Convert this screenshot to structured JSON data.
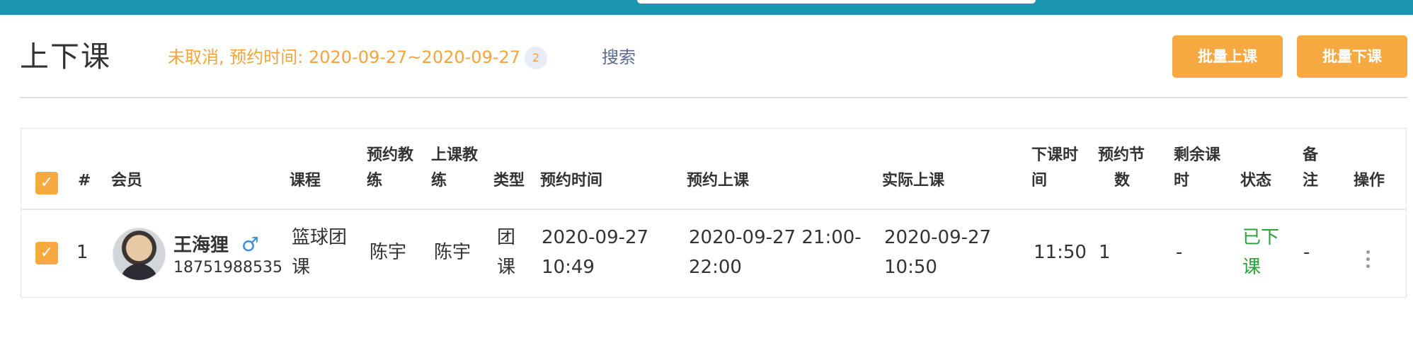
{
  "page": {
    "title": "上下课",
    "filter_text": "未取消, 预约时间: 2020-09-27~2020-09-27",
    "filter_count": "2",
    "search_label": "搜索"
  },
  "toolbar": {
    "batch_start": "批量上课",
    "batch_end": "批量下课"
  },
  "colors": {
    "topbar": "#1a96ae",
    "accent": "#f7a941",
    "status_done": "#2aa13b"
  },
  "table": {
    "headers": {
      "index": "#",
      "member": "会员",
      "course": "课程",
      "booked_coach_1": "预约教",
      "booked_coach_2": "练",
      "class_coach_1": "上课教",
      "class_coach_2": "练",
      "type": "类型",
      "booking_time": "预约时间",
      "booked_class": "预约上课",
      "actual_class": "实际上课",
      "end_time_1": "下课时",
      "end_time_2": "间",
      "sessions_1": "预约节",
      "sessions_2": "数",
      "remaining_1": "剩余课",
      "remaining_2": "时",
      "status": "状态",
      "remark_1": "备",
      "remark_2": "注",
      "actions": "操作"
    },
    "rows": [
      {
        "index": "1",
        "member_name": "王海狸",
        "member_gender": "♂",
        "member_phone": "18751988535",
        "course_1": "篮球团",
        "course_2": "课",
        "booked_coach": "陈宇",
        "class_coach": "陈宇",
        "type_1": "团",
        "type_2": "课",
        "booking_date": "2020-09-27",
        "booking_time": "10:49",
        "booked_class_1": "2020-09-27 21:00-",
        "booked_class_2": "22:00",
        "actual_date": "2020-09-27",
        "actual_time": "10:50",
        "end_time": "11:50",
        "sessions": "1",
        "remaining": "-",
        "status_1": "已下",
        "status_2": "课",
        "remark": "-"
      }
    ]
  }
}
